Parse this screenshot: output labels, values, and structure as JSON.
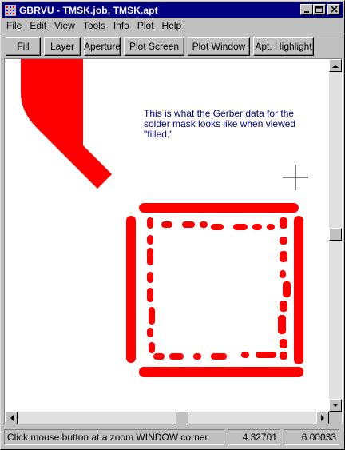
{
  "window": {
    "title": "GBRVU - TMSK.job, TMSK.apt",
    "buttons": {
      "minimize": "minimize",
      "maximize": "maximize",
      "close": "close"
    }
  },
  "menu": [
    "File",
    "Edit",
    "View",
    "Tools",
    "Info",
    "Plot",
    "Help"
  ],
  "toolbar": [
    "Fill",
    "Layer",
    "Aperture",
    "Plot Screen",
    "Plot Window",
    "Apt. Highlight"
  ],
  "canvas": {
    "annotation": "This is what the Gerber data for the solder mask looks like when viewed \"filled.\"",
    "fill_color": "#ff0000",
    "background": "#ffffff",
    "annotation_color": "#000080",
    "cursor": "crosshair"
  },
  "scroll": {
    "vertical_position": 0.5,
    "horizontal_position": 0.55
  },
  "status": {
    "message": "Click mouse button at a zoom WINDOW corner",
    "x": "4.32701",
    "y": "6.00033"
  }
}
